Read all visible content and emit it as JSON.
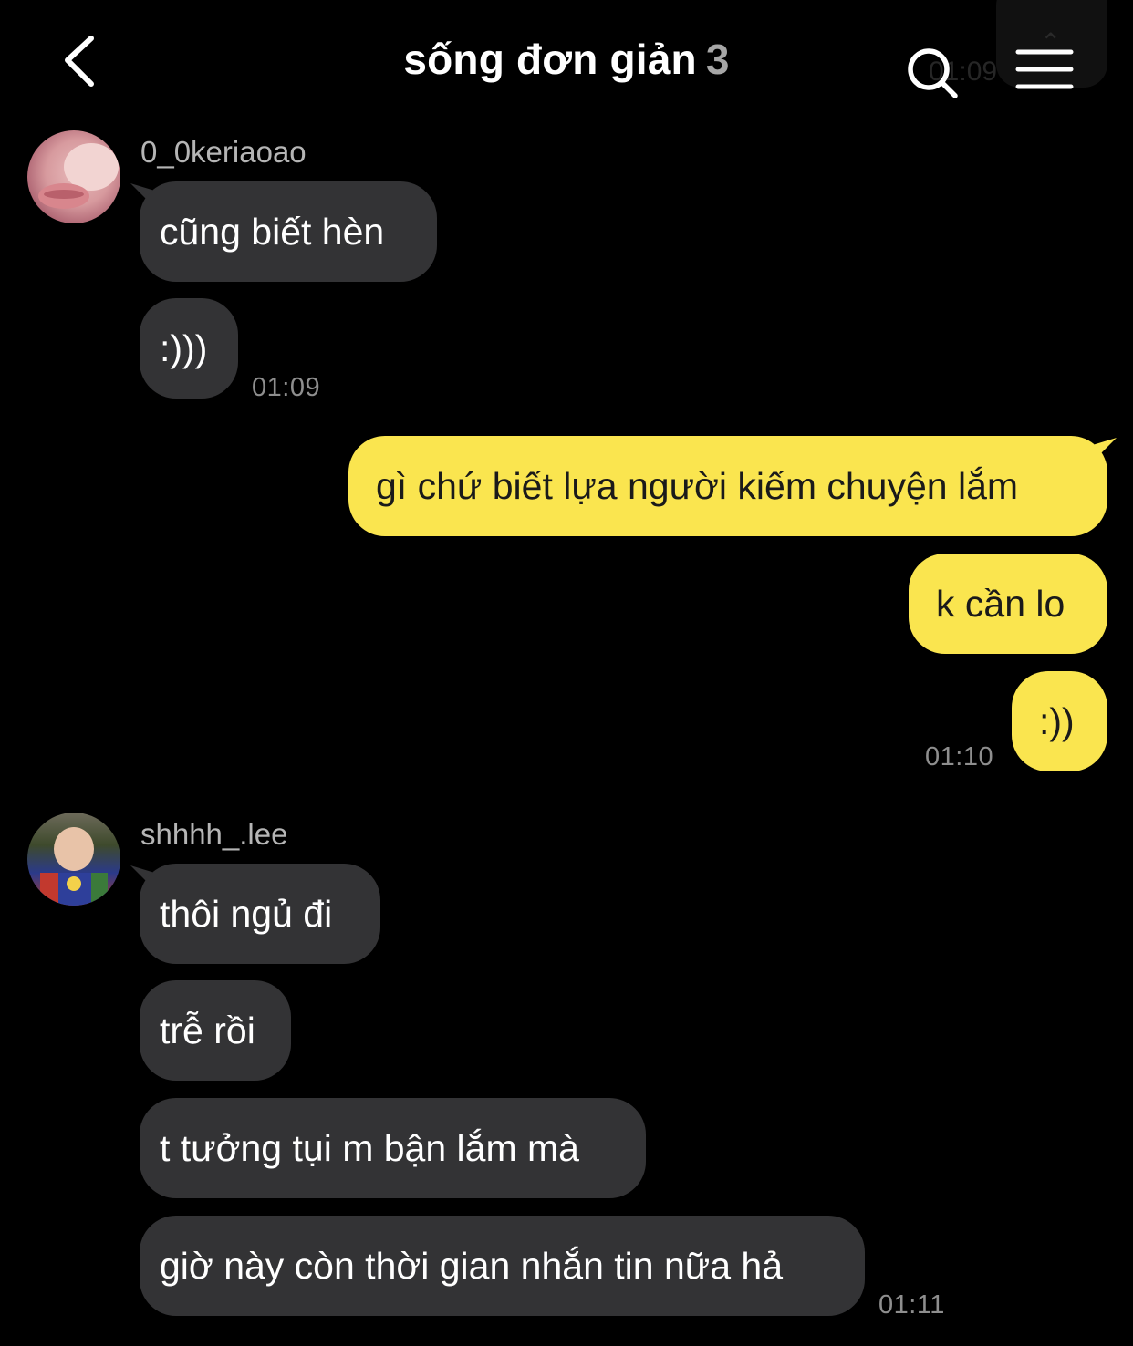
{
  "header": {
    "title": "sống đơn giản",
    "member_count": "3",
    "faded_time": "01:09"
  },
  "colors": {
    "background": "#000000",
    "incoming_bubble": "#333335",
    "outgoing_bubble": "#fae54f",
    "outgoing_text": "#1a1a1a",
    "timestamp": "#8e8e8e"
  },
  "icons": [
    "back-arrow-icon",
    "search-icon",
    "menu-icon"
  ],
  "groups": [
    {
      "sender": "0_0keriaoao",
      "messages": [
        "cũng biết hèn",
        ":)))"
      ],
      "time": "01:09"
    },
    {
      "sender": "me",
      "messages": [
        "gì chứ biết lựa người kiếm chuyện lắm",
        "k cần lo",
        ":))"
      ],
      "time": "01:10"
    },
    {
      "sender": "shhhh_.lee",
      "messages": [
        "thôi ngủ đi",
        "trễ rồi",
        "t tưởng tụi m bận lắm mà",
        "giờ này còn thời gian nhắn tin nữa hả"
      ],
      "time": "01:11"
    }
  ]
}
